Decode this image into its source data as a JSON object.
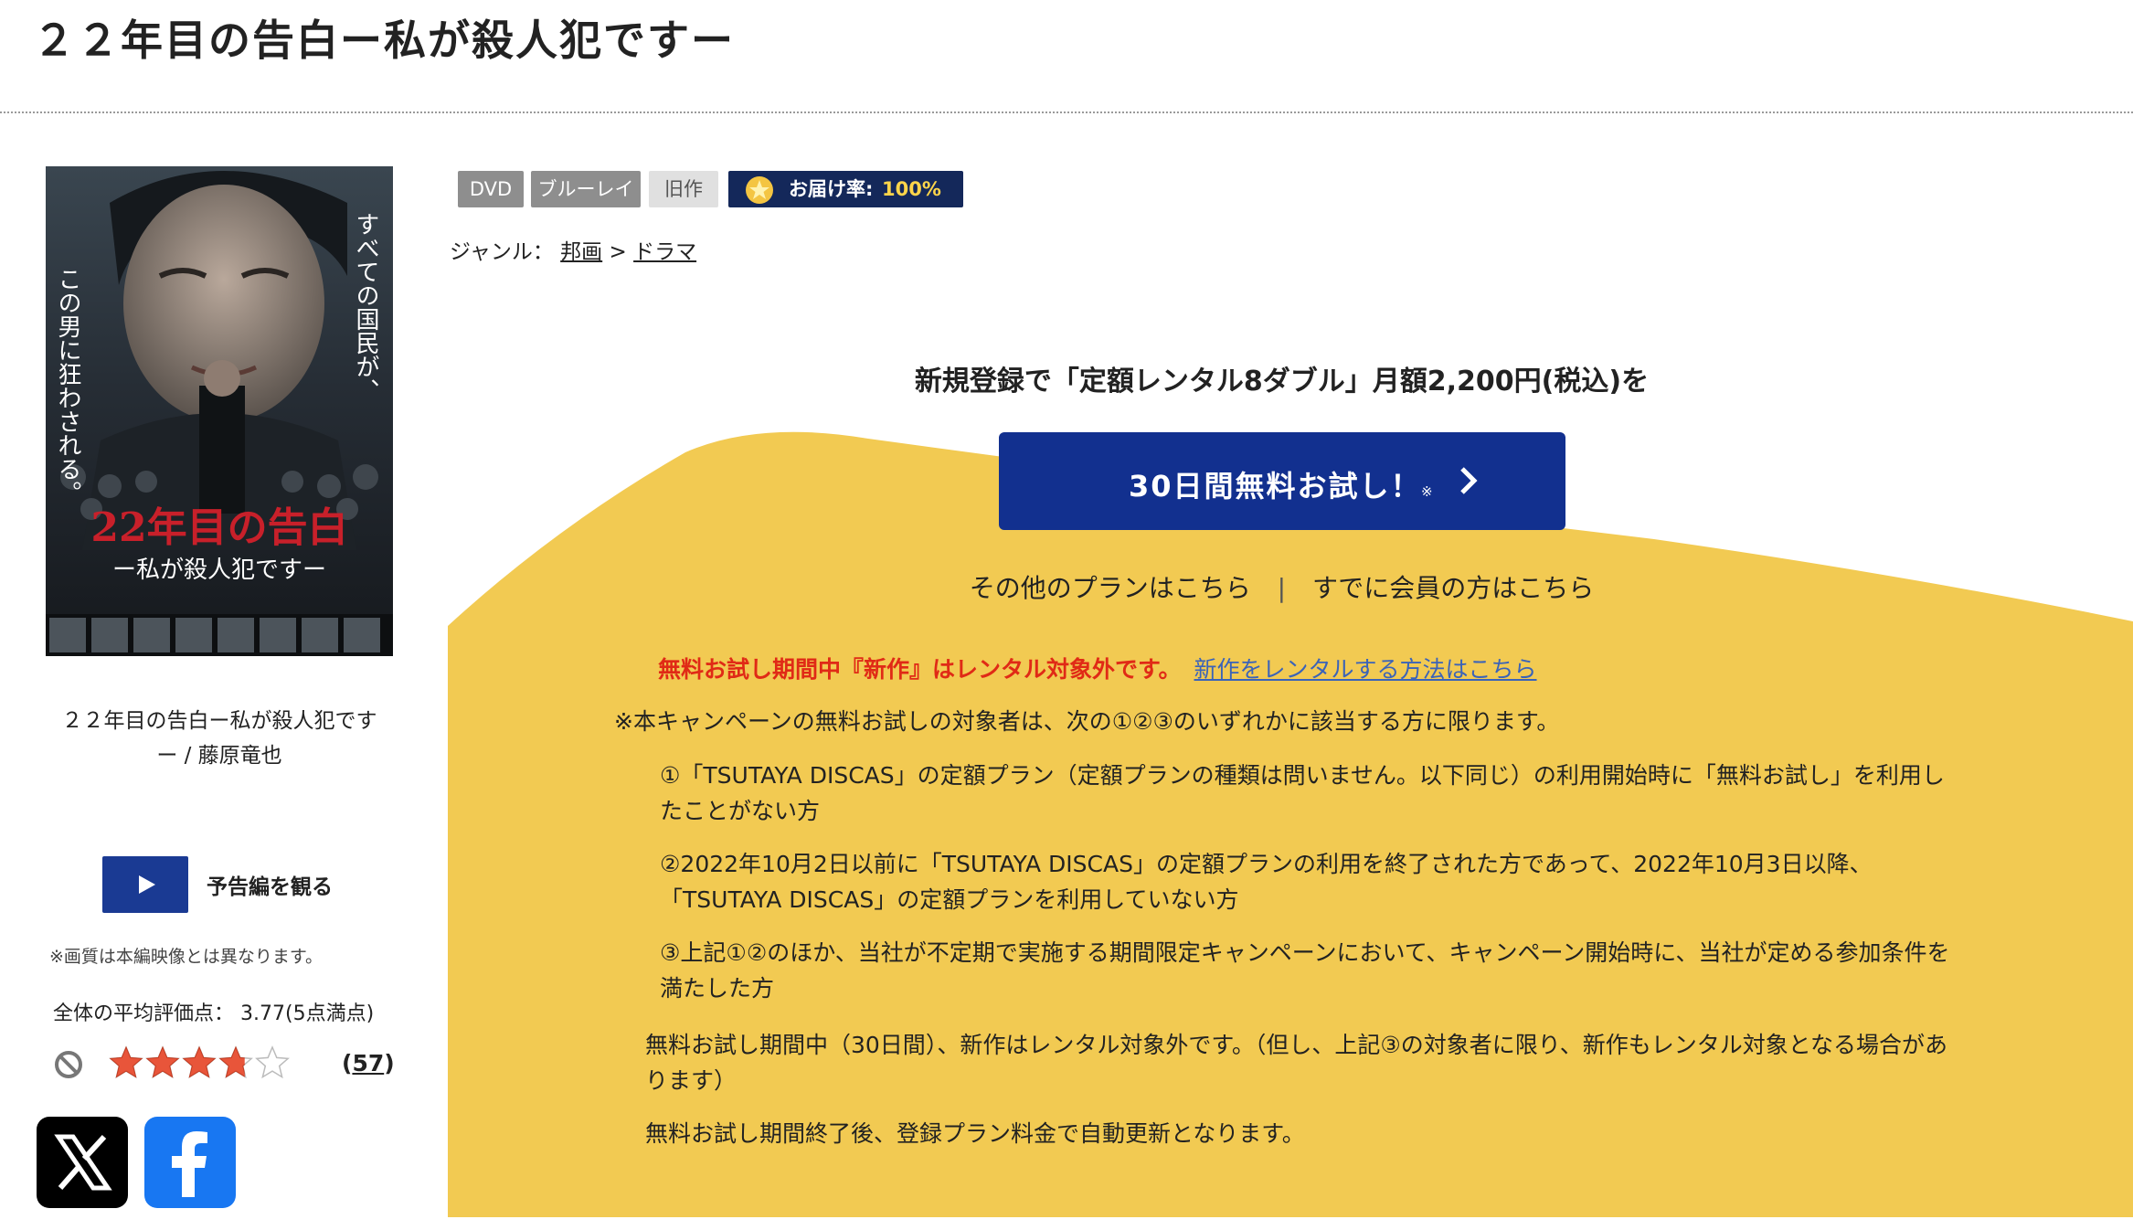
{
  "page": {
    "title": "２２年目の告白ー私が殺人犯ですー"
  },
  "product": {
    "caption_line1": "２２年目の告白ー私が殺人犯です",
    "caption_line2": "ー / 藤原竜也",
    "poster_text": {
      "vertical_right": "すべての国民が、",
      "vertical_left": "この男に狂わされる。",
      "title_main": "22年目の告白",
      "title_sub": "ー私が殺人犯ですー"
    },
    "trailer_label": "予告編を観る",
    "quality_note": "※画質は本編映像とは異なります。",
    "avg_rating_label": "全体の平均評価点：",
    "avg_rating_value": "3.77(5点満点)",
    "rating": 3.77,
    "review_count_open": "(",
    "review_count": "57",
    "review_count_close": ")"
  },
  "badges": {
    "dvd": "DVD",
    "bluray": "ブルーレイ",
    "old": "旧作",
    "delivery_label": "お届け率:",
    "delivery_value": "100%"
  },
  "genre": {
    "label": "ジャンル：",
    "level1": "邦画",
    "separator": ">",
    "level2": "ドラマ"
  },
  "campaign": {
    "headline": "新規登録で「定額レンタル8ダブル」月額2,200円(税込)を",
    "button_label": "30日間無料お試し！",
    "button_mark": "※",
    "other_plans": "その他のプランはこちら",
    "link_separator": "|",
    "members": "すでに会員の方はこちら",
    "notice_red": "無料お試し期間中『新作』はレンタル対象外です。",
    "notice_link": "新作をレンタルする方法はこちら",
    "eligibility_intro": "※本キャンペーンの無料お試しの対象者は、次の①②③のいずれかに該当する方に限ります。",
    "item1": "①「TSUTAYA DISCAS」の定額プラン（定額プランの種類は問いません。以下同じ）の利用開始時に「無料お試し」を利用したことがない方",
    "item2": "②2022年10月2日以前に「TSUTAYA DISCAS」の定額プランの利用を終了された方であって、2022年10月3日以降、「TSUTAYA DISCAS」の定額プランを利用していない方",
    "item3": "③上記①②のほか、当社が不定期で実施する期間限定キャンペーンにおいて、キャンペーン開始時に、当社が定める参加条件を満たした方",
    "trial_note": "無料お試し期間中（30日間）、新作はレンタル対象外です。（但し、上記③の対象者に限り、新作もレンタル対象となる場合があります）",
    "renewal_note": "無料お試し期間終了後、登録プラン料金で自動更新となります。"
  },
  "colors": {
    "campaign_bg": "#f2ca52",
    "button_blue": "#12308f",
    "notice_red": "#e02a16",
    "link_blue": "#3b63b8",
    "star_fill": "#e8553a",
    "delivery_badge_bg": "#14285a",
    "delivery_value": "#ffd54a"
  },
  "icons": {
    "trailer": "play-icon",
    "no_rating": "prohibited-icon",
    "stars": "star-icon",
    "x": "x-logo-icon",
    "facebook": "facebook-logo-icon",
    "button": "chevron-right-icon",
    "delivery": "star-badge-icon"
  }
}
